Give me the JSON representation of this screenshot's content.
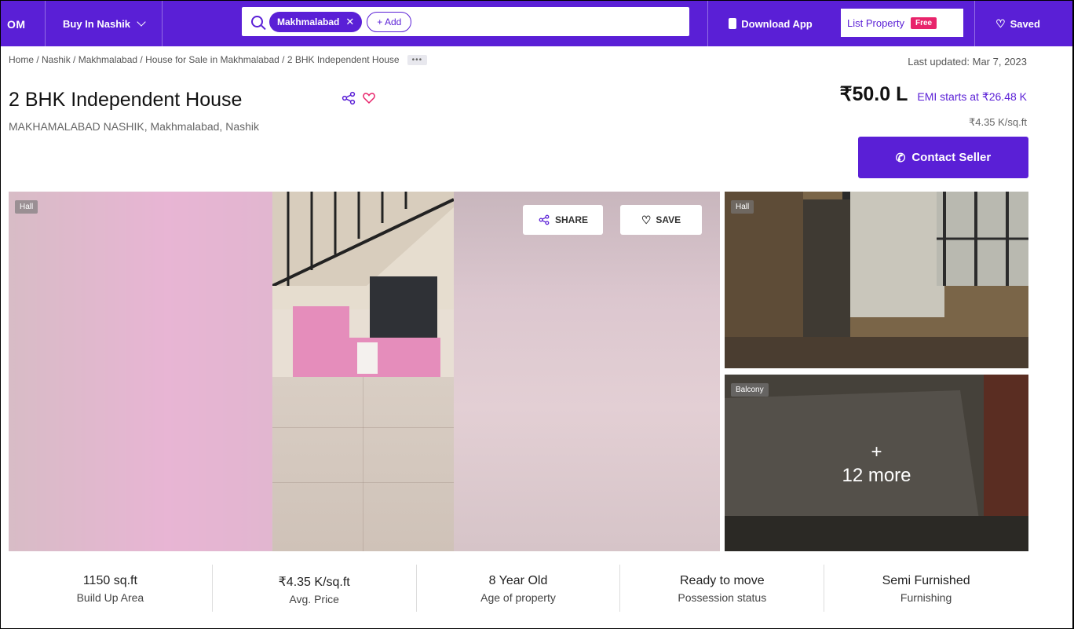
{
  "nav": {
    "logo": "OM",
    "city_menu": "Buy In Nashik",
    "search_chip": "Makhmalabad",
    "add_chip": "+ Add",
    "download": "Download App",
    "list_property": "List Property",
    "free_badge": "Free",
    "saved": "Saved"
  },
  "breadcrumb": "Home / Nashik / Makhmalabad / House for Sale in Makhmalabad / 2 BHK Independent House",
  "breadcrumb_more": "•••",
  "last_updated": "Last updated: Mar 7, 2023",
  "listing": {
    "title": "2 BHK Independent House",
    "address": "MAKHAMALABAD NASHIK, Makhmalabad, Nashik",
    "price": "₹50.0 L",
    "emi": "EMI starts at ₹26.48 K",
    "price_per_sqft": "₹4.35 K/sq.ft",
    "contact_button": "Contact Seller"
  },
  "gallery": {
    "main_tag": "Hall",
    "share": "SHARE",
    "save": "SAVE",
    "thumb1_tag": "Hall",
    "thumb2_tag": "Balcony",
    "more_plus": "+",
    "more_count": "12 more"
  },
  "stats": [
    {
      "value": "1150 sq.ft",
      "label": "Build Up Area"
    },
    {
      "value": "₹4.35 K/sq.ft",
      "label": "Avg. Price"
    },
    {
      "value": "8 Year Old",
      "label": "Age of property"
    },
    {
      "value": "Ready to move",
      "label": "Possession status"
    },
    {
      "value": "Semi Furnished",
      "label": "Furnishing"
    }
  ],
  "colors": {
    "brand": "#5a1fd6",
    "free_badge": "#e8246b"
  }
}
